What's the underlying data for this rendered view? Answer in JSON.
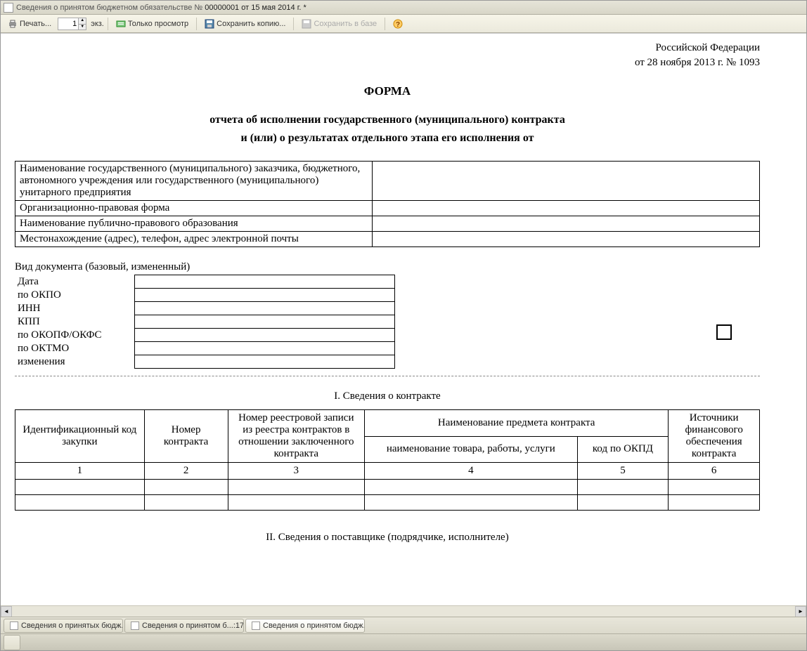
{
  "titlebar": {
    "prefix": "Сведения о принятом бюджетном обязательстве №",
    "doc_number": "00000001 от 15 мая 2014 г. *"
  },
  "toolbar": {
    "print_label": "Печать...",
    "copies_value": "1",
    "copies_unit": "экз.",
    "view_only_label": "Только просмотр",
    "save_copy_label": "Сохранить копию...",
    "save_db_label": "Сохранить в базе"
  },
  "document": {
    "header_right_line1": "Российской Федерации",
    "header_right_line2": "от 28 ноября 2013 г. № 1093",
    "title": "ФОРМА",
    "subtitle_line1": "отчета об исполнении государственного (муниципального) контракта",
    "subtitle_line2": "и (или) о результатах отдельного этапа его исполнения от",
    "form_rows": [
      "Наименование государственного (муниципального) заказчика, бюджетного, автономного учреждения или государственного (муниципального) унитарного предприятия",
      "Организационно-правовая форма",
      "Наименование публично-правового образования",
      "Местонахождение (адрес), телефон, адрес электронной почты"
    ],
    "doc_type_label": "Вид документа (базовый, измененный)",
    "small_rows": [
      "Дата",
      "по ОКПО",
      "ИНН",
      "КПП",
      "по ОКОПФ/ОКФС",
      "по ОКТМО",
      "изменения"
    ],
    "section1_title": "I. Сведения о контракте",
    "table1": {
      "col1": "Идентификационный код закупки",
      "col2": "Номер контракта",
      "col3": "Номер реестровой записи из реестра контрактов в отношении заключенного контракта",
      "col4_top": "Наименование предмета контракта",
      "col4a": "наименование товара, работы, услуги",
      "col4b": "код по ОКПД",
      "col5": "Источники финансового обеспечения контракта",
      "nums": [
        "1",
        "2",
        "3",
        "4",
        "5",
        "6"
      ]
    },
    "section2_title": "II. Сведения о поставщике (подрядчике, исполнителе)"
  },
  "tabs": [
    "Сведения о принятых бюдж...",
    "Сведения о принятом б...:17",
    "Сведения о принятом бюдж..."
  ]
}
